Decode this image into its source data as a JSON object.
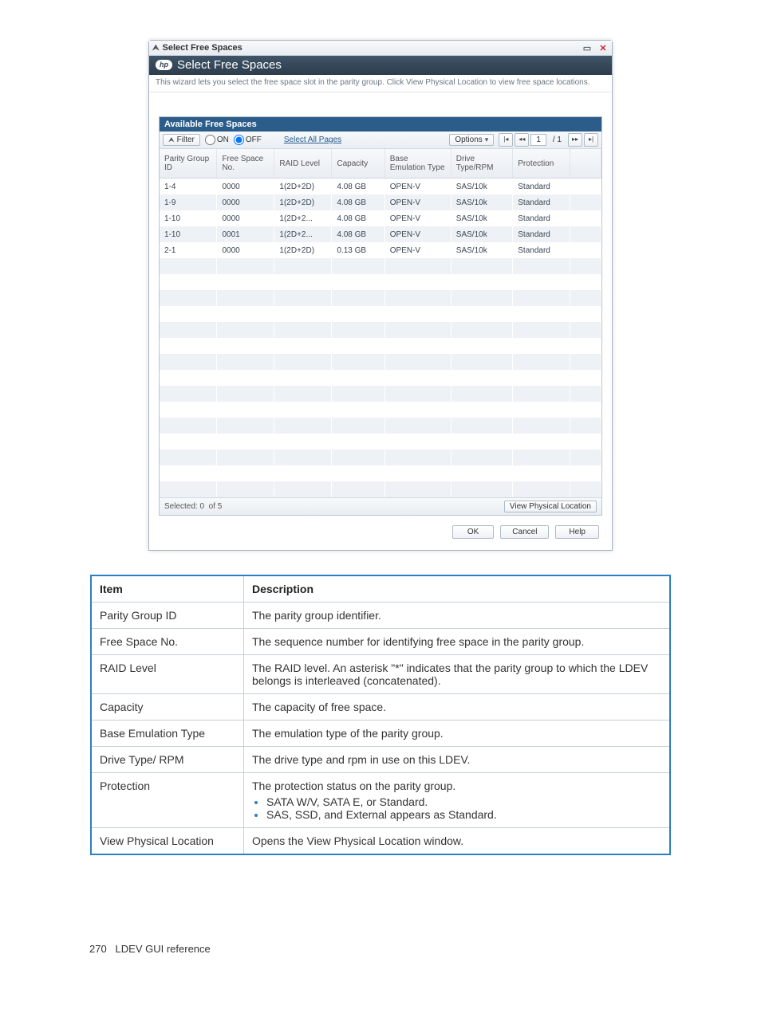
{
  "window": {
    "titlebar_label": "Select Free Spaces",
    "header_title": "Select Free Spaces",
    "subheader": "This wizard lets you select the free space slot in the parity group. Click View Physical Location to view free space locations."
  },
  "panel": {
    "title": "Available Free Spaces"
  },
  "toolbar": {
    "filter_label": "Filter",
    "on_label": "ON",
    "off_label": "OFF",
    "select_all_label": "Select All Pages",
    "options_label": "Options",
    "page_current": "1",
    "page_total": "/ 1"
  },
  "columns": {
    "c0": "Parity Group ID",
    "c1": "Free Space No.",
    "c2": "RAID Level",
    "c3": "Capacity",
    "c4": "Base Emulation Type",
    "c5": "Drive Type/RPM",
    "c6": "Protection"
  },
  "rows": [
    {
      "c0": "1-4",
      "c1": "0000",
      "c2": "1(2D+2D)",
      "c3": "4.08 GB",
      "c4": "OPEN-V",
      "c5": "SAS/10k",
      "c6": "Standard"
    },
    {
      "c0": "1-9",
      "c1": "0000",
      "c2": "1(2D+2D)",
      "c3": "4.08 GB",
      "c4": "OPEN-V",
      "c5": "SAS/10k",
      "c6": "Standard"
    },
    {
      "c0": "1-10",
      "c1": "0000",
      "c2": "1(2D+2...",
      "c3": "4.08 GB",
      "c4": "OPEN-V",
      "c5": "SAS/10k",
      "c6": "Standard"
    },
    {
      "c0": "1-10",
      "c1": "0001",
      "c2": "1(2D+2...",
      "c3": "4.08 GB",
      "c4": "OPEN-V",
      "c5": "SAS/10k",
      "c6": "Standard"
    },
    {
      "c0": "2-1",
      "c1": "0000",
      "c2": "1(2D+2D)",
      "c3": "0.13 GB",
      "c4": "OPEN-V",
      "c5": "SAS/10k",
      "c6": "Standard"
    }
  ],
  "footer": {
    "selected_label": "Selected:",
    "selected_count": "0",
    "of_label": "of",
    "total_count": "5",
    "view_btn": "View Physical Location"
  },
  "dlg_buttons": {
    "ok": "OK",
    "cancel": "Cancel",
    "help": "Help"
  },
  "desc_table": {
    "hdr_item": "Item",
    "hdr_desc": "Description",
    "rows": [
      {
        "item": "Parity Group ID",
        "desc": "The parity group identifier."
      },
      {
        "item": "Free Space No.",
        "desc": "The sequence number for identifying free space in the parity group."
      },
      {
        "item": "RAID Level",
        "desc": "The RAID level. An asterisk \"*\" indicates that the parity group to which the LDEV belongs is interleaved (concatenated)."
      },
      {
        "item": "Capacity",
        "desc": "The capacity of free space."
      },
      {
        "item": "Base Emulation Type",
        "desc": "The emulation type of the parity group."
      },
      {
        "item": "Drive Type/ RPM",
        "desc": "The drive type and rpm in use on this LDEV."
      },
      {
        "item": "Protection",
        "desc": "The protection status on the parity group.",
        "bullets": [
          "SATA W/V, SATA E, or Standard.",
          "SAS, SSD, and External appears as Standard."
        ]
      },
      {
        "item": "View Physical Location",
        "desc": "Opens the View Physical Location window."
      }
    ]
  },
  "page_footer": {
    "page_no": "270",
    "section": "LDEV GUI reference"
  }
}
